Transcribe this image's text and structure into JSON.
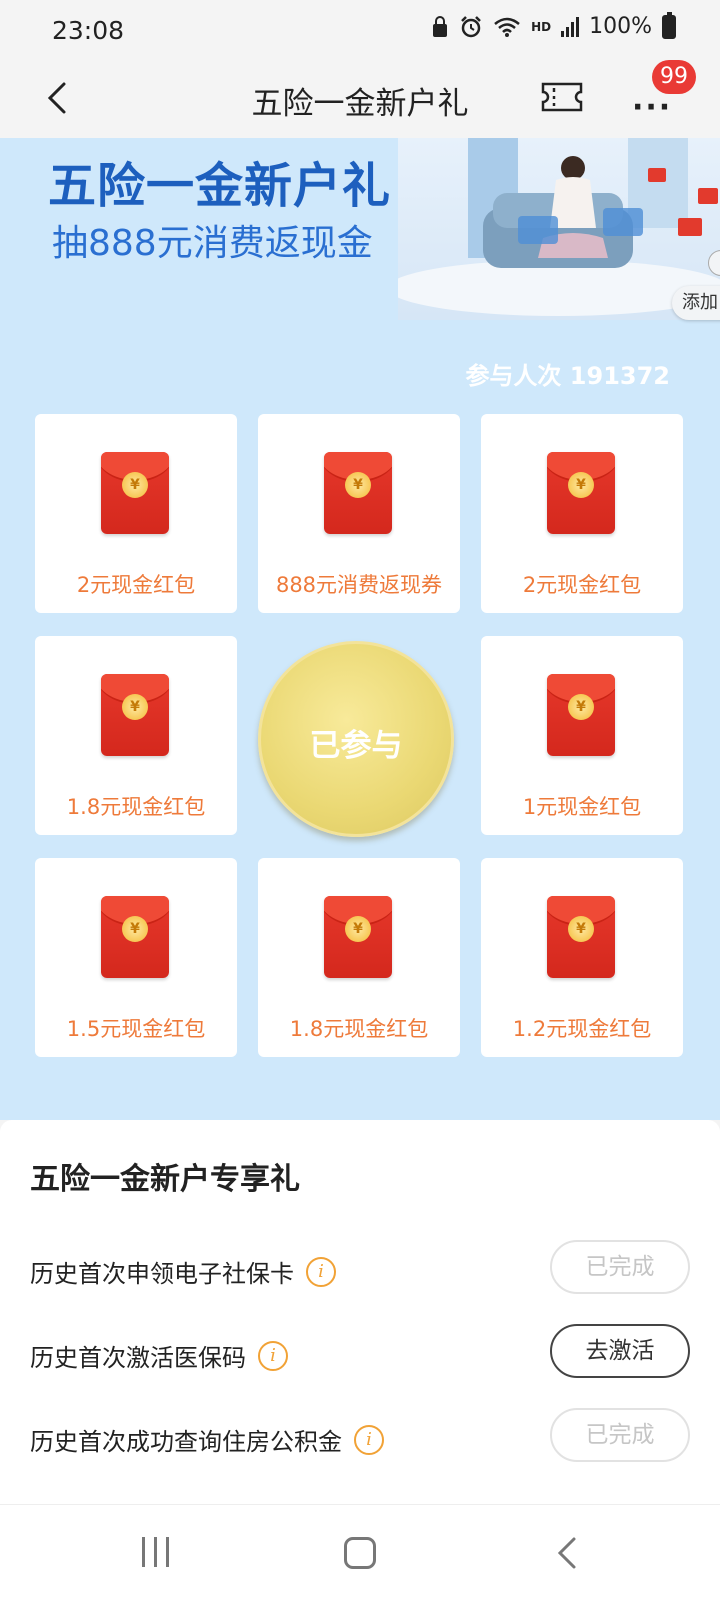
{
  "status_bar": {
    "time": "23:08",
    "network_label": "HD",
    "battery_text": "100%"
  },
  "header": {
    "title": "五险一金新户礼",
    "more_label": "···",
    "badge_count": "99"
  },
  "hero": {
    "title": "五险一金新户礼",
    "subtitle": "抽888元消费返现金",
    "add_label": "添加",
    "participants_text": "参与人次 191372"
  },
  "prizes": [
    {
      "label": "2元现金红包",
      "icon": "red-envelope-icon"
    },
    {
      "label": "888元消费返现券",
      "icon": "red-envelope-icon"
    },
    {
      "label": "2元现金红包",
      "icon": "red-envelope-icon"
    },
    {
      "label": "1.8元现金红包",
      "icon": "red-envelope-icon"
    },
    {
      "label": "1元现金红包",
      "icon": "red-envelope-icon"
    },
    {
      "label": "1.5元现金红包",
      "icon": "red-envelope-icon"
    },
    {
      "label": "1.8元现金红包",
      "icon": "red-envelope-icon"
    },
    {
      "label": "1.2元现金红包",
      "icon": "red-envelope-icon"
    }
  ],
  "coin_symbol": "¥",
  "draw_button": {
    "label": "已参与"
  },
  "tasks": {
    "title": "五险一金新户专享礼",
    "items": [
      {
        "label": "历史首次申领电子社保卡",
        "button": "已完成",
        "state": "done"
      },
      {
        "label": "历史首次激活医保码",
        "button": "去激活",
        "state": "active"
      },
      {
        "label": "历史首次成功查询住房公积金",
        "button": "已完成",
        "state": "done"
      }
    ],
    "info_glyph": "i"
  },
  "colors": {
    "hero_bg": "#cfe8fb",
    "title_blue": "#1d5fbe",
    "prize_text": "#ee7a3a",
    "envelope_red": "#e6382b",
    "badge_red": "#e93a35",
    "info_orange": "#f1a236"
  }
}
